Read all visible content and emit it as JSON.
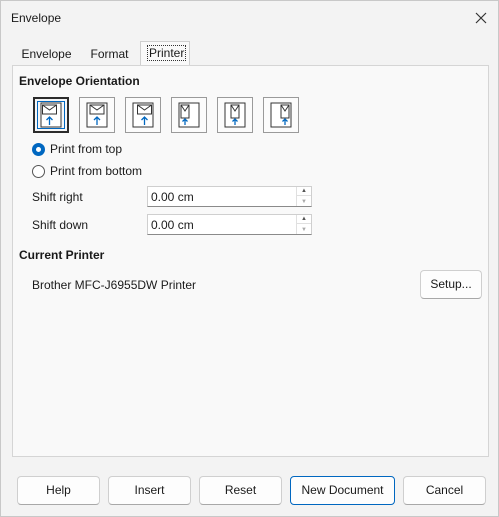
{
  "window": {
    "title": "Envelope"
  },
  "tabs": [
    {
      "label": "Envelope"
    },
    {
      "label": "Format"
    },
    {
      "label": "Printer"
    }
  ],
  "orientation": {
    "heading": "Envelope Orientation",
    "selected_index": 0,
    "options": [
      {
        "icon": "envelope-horizontal-left-icon"
      },
      {
        "icon": "envelope-horizontal-center-icon"
      },
      {
        "icon": "envelope-horizontal-right-icon"
      },
      {
        "icon": "envelope-vertical-left-icon"
      },
      {
        "icon": "envelope-vertical-center-icon"
      },
      {
        "icon": "envelope-vertical-right-icon"
      }
    ]
  },
  "print_from": {
    "top_label": "Print from top",
    "bottom_label": "Print from bottom",
    "selected": "top"
  },
  "shift": {
    "right_label": "Shift right",
    "right_value": "0.00 cm",
    "down_label": "Shift down",
    "down_value": "0.00 cm"
  },
  "printer": {
    "heading": "Current Printer",
    "name": "Brother MFC-J6955DW Printer",
    "setup_label": "Setup..."
  },
  "footer": {
    "help": "Help",
    "insert": "Insert",
    "reset": "Reset",
    "new_document": "New Document",
    "cancel": "Cancel"
  },
  "colors": {
    "accent": "#0067c0"
  }
}
